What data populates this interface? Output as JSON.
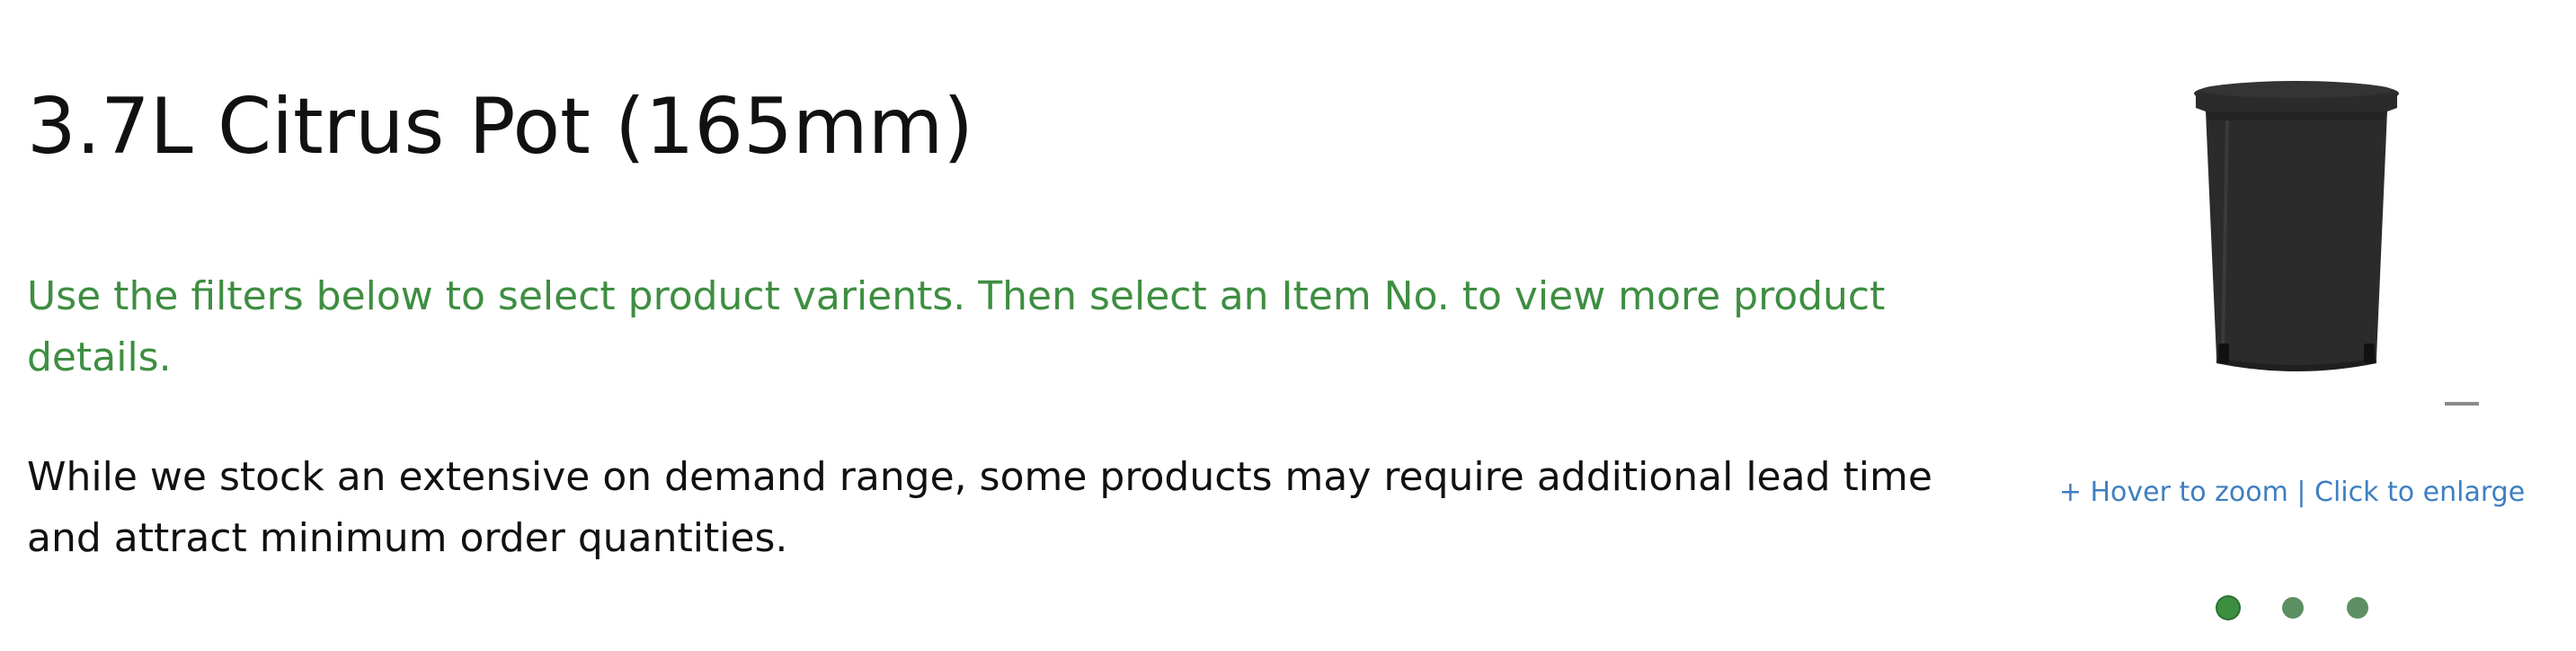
{
  "product": {
    "title": "3.7L Citrus Pot (165mm)",
    "filter_instructions": "Use the filters below to select product varients. Then select an Item No. to view more product details.",
    "stock_notice": "While we stock an extensive on demand range, some products may require additional lead time and attract minimum order quantities."
  },
  "gallery": {
    "image_icon": "black-plant-pot-image",
    "zoom_hint": "+ Hover to zoom | Click to enlarge",
    "slides": 3,
    "active_slide": 1,
    "colors": {
      "accent_green": "#3e8e41",
      "link_blue": "#3f7fbf",
      "pot_black": "#2b2b2b"
    }
  }
}
